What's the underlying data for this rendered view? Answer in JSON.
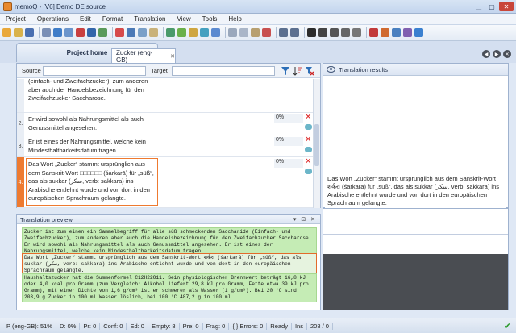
{
  "window": {
    "title": "memoQ - [V6] Demo DE source"
  },
  "menu": [
    "Project",
    "Operations",
    "Edit",
    "Format",
    "Translation",
    "View",
    "Tools",
    "Help"
  ],
  "tabs": {
    "home": "Project home",
    "document": "Zucker (eng-GB)"
  },
  "filter": {
    "source_label": "Source",
    "target_label": "Target"
  },
  "segments": [
    {
      "num": "",
      "text": "(einfach- und Zweifachzucker), zum anderen aber auch der Handelsbezeichnung für den Zweifachzucker Saccharose.",
      "pct": ""
    },
    {
      "num": "2.",
      "text": "Er wird sowohl als Nahrungsmittel als auch Genussmittel angesehen.",
      "pct": "0%"
    },
    {
      "num": "3.",
      "text": "Er ist eines der Nahrungsmittel, welche kein Mindesthaltbarkeitsdatum tragen.",
      "pct": "0%"
    },
    {
      "num": "4.",
      "text": "Das Wort „Zucker“ stammt ursprünglich aus dem Sanskrit-Wort □□□□□□ (śarkarā) für „süß“, das als sukkar (سكر, verb: sakkara) ins Arabische entlehnt wurde und von dort in den europäischen Sprachraum gelangte.",
      "pct": "0%"
    }
  ],
  "results": {
    "header": "Translation results",
    "match_text": "Das Wort „Zucker“ stammt ursprünglich aus dem Sanskrit-Wort शर्करा (śarkarā) für „süß“, das als sukkar (سكر, verb: sakkara) ins Arabische entlehnt wurde und von dort in den europäischen Sprachraum gelangte."
  },
  "preview": {
    "header": "Translation preview",
    "ctrls": "▾ ⊡ ✕",
    "paragraphs": [
      "Zucker ist zum einen ein Sammelbegriff für alle süß schmeckenden Saccharide (Einfach- und Zweifachzucker), zum anderen aber auch die Handelsbezeichnung für den Zweifachzucker Saccharose. Er wird sowohl als Nahrungsmittel als auch Genussmittel angesehen. Er ist eines der Nahrungsmittel, welche kein Mindesthaltbarkeitsdatum tragen.",
      "Das Wort „Zucker“ stammt ursprünglich aus dem Sanskrit-Wort शर्करा (śarkarā) für „süß“, das als sukkar (سكر, verb: sakkara) ins Arabische entlehnt wurde und von dort in den europäischen Sprachraum gelangte.",
      "Haushaltszucker hat die Summenformel C12H22O11. Sein physiologischer Brennwert beträgt 16,8 kJ oder 4,0 kcal pro Gramm (zum Vergleich: Alkohol liefert 29,8 kJ pro Gramm, Fette etwa 39 kJ pro Gramm), mit einer Dichte von 1,6 g/cm³ ist er schwerer als Wasser (1 g/cm³). Bei 20 °C sind 203,9 g Zucker in 100 ml Wasser löslich, bei 100 °C 487,2 g in 100 ml."
    ]
  },
  "status": {
    "items": [
      "P (eng-GB): 51%",
      "D: 0%",
      "Pr: 0",
      "Conf: 0",
      "Ed: 0",
      "Empty: 8",
      "Pre: 0",
      "Frag: 0",
      "{ } Errors: 0",
      "Ready",
      "Ins",
      "208 / 0"
    ]
  },
  "colors": {
    "accent": "#ee7a30",
    "preview_green": "#c5ecb5"
  }
}
